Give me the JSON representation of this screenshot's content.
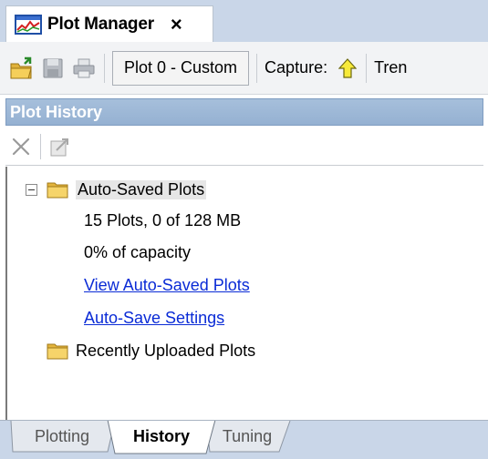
{
  "window": {
    "tab_title": "Plot Manager",
    "tab_icon": "plot-manager-icon",
    "close_glyph": "×"
  },
  "toolbar": {
    "plot_selector_value": "Plot 0 - Custom",
    "capture_label": "Capture:",
    "trend_label_partial": "Tren",
    "icons": [
      "open-folder-icon",
      "save-icon",
      "print-icon",
      "capture-arrow-icon"
    ]
  },
  "panel": {
    "title": "Plot History",
    "tools": [
      "delete-icon",
      "export-icon"
    ]
  },
  "tree": {
    "auto_saved": {
      "label": "Auto-Saved Plots",
      "summary": "15 Plots, 0 of 128 MB",
      "capacity": "0% of capacity",
      "view_link": "View Auto-Saved Plots",
      "settings_link": "Auto-Save Settings"
    },
    "recent": {
      "label": "Recently Uploaded Plots"
    }
  },
  "bottom_tabs": [
    {
      "label": "Plotting",
      "active": false
    },
    {
      "label": "History",
      "active": true
    },
    {
      "label": "Tuning",
      "active": false
    }
  ],
  "colors": {
    "header_bg": "#95b1d2",
    "link": "#0a2bd6",
    "tab_strip": "#c9d6e8"
  }
}
